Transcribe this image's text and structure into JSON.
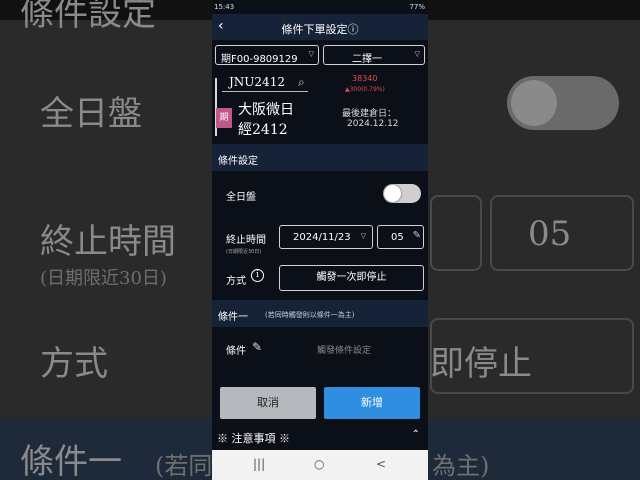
{
  "background": {
    "title_partial": "條件設定",
    "all_day": "全日盤",
    "end_time": "終止時間",
    "end_time_note": "(日期限近30日)",
    "minute": "05",
    "method": "方式",
    "method_value": "即停止",
    "cond_one": "條件一",
    "cond_one_note": "(若同",
    "cond_one_note_end": "為主)"
  },
  "status_bar": {
    "time": "15:43",
    "right": "77%"
  },
  "header": {
    "back": "‹",
    "title": "條件下單設定ⓘ"
  },
  "selectors": {
    "account": "期F00-9809129",
    "option": "二擇一"
  },
  "quote": {
    "code": "JNU2412",
    "price": "38340",
    "change": "▲300(0.79%)",
    "tag": "期",
    "name_line1": "大阪微日",
    "name_line2": "經2412",
    "last_trade_label": "最後建倉日：",
    "last_trade_date": "2024.12.12"
  },
  "condition_settings": {
    "section_title": "條件設定",
    "all_day_label": "全日盤",
    "all_day_on": false,
    "end_time_label": "終止時間",
    "end_time_note": "(日期限近30日)",
    "end_date": "2024/11/23",
    "end_minute": "05",
    "method_label": "方式",
    "method_value": "觸發一次即停止"
  },
  "condition_one": {
    "section_title": "條件一",
    "note": "(若同時觸發則以條件一為主)",
    "label": "條件",
    "placeholder": "觸發條件設定"
  },
  "actions": {
    "cancel": "取消",
    "add": "新增"
  },
  "notice": {
    "title": "※ 注意事項 ※",
    "chevron": "⌃"
  },
  "system_nav": {
    "recents": "|||",
    "home": "○",
    "back": "<"
  },
  "colors": {
    "primary_button": "#2f8ee0",
    "section_bg": "#162238",
    "price_up": "#e34b4b",
    "tag": "#c0578a"
  }
}
